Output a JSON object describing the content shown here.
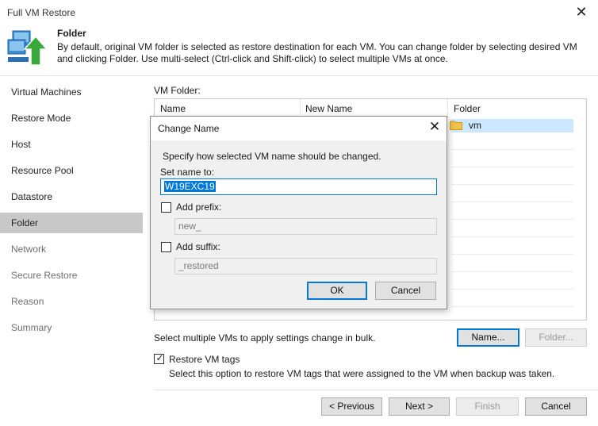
{
  "window": {
    "title": "Full VM Restore",
    "close_glyph": "✕"
  },
  "header": {
    "title": "Folder",
    "description": "By default, original VM folder is selected as restore destination for each VM. You can change folder by selecting desired VM and clicking Folder. Use multi-select (Ctrl-click and Shift-click) to select multiple VMs at once.",
    "icon": "vm-restore-icon"
  },
  "sidebar": {
    "items": [
      {
        "label": "Virtual Machines",
        "state": "normal"
      },
      {
        "label": "Restore Mode",
        "state": "normal"
      },
      {
        "label": "Host",
        "state": "normal"
      },
      {
        "label": "Resource Pool",
        "state": "normal"
      },
      {
        "label": "Datastore",
        "state": "normal"
      },
      {
        "label": "Folder",
        "state": "active"
      },
      {
        "label": "Network",
        "state": "disabled"
      },
      {
        "label": "Secure Restore",
        "state": "disabled"
      },
      {
        "label": "Reason",
        "state": "disabled"
      },
      {
        "label": "Summary",
        "state": "disabled"
      }
    ]
  },
  "main": {
    "vm_folder_label": "VM Folder:",
    "table": {
      "columns": [
        "Name",
        "New Name",
        "Folder"
      ],
      "rows": [
        {
          "folder": "vm",
          "selected": true
        }
      ]
    },
    "bulk_text": "Select multiple VMs to apply settings change in bulk.",
    "name_button": "Name...",
    "folder_button": "Folder...",
    "restore_tags": {
      "label": "Restore VM tags",
      "checked": true,
      "description": "Select this option to restore VM tags that were assigned to the VM when backup was taken."
    }
  },
  "footer": {
    "previous": "< Previous",
    "next": "Next >",
    "finish": "Finish",
    "cancel": "Cancel"
  },
  "dialog": {
    "title": "Change Name",
    "close_glyph": "✕",
    "description": "Specify how selected VM name should be changed.",
    "set_name_label": "Set name to:",
    "set_name_value": "W19EXC19",
    "prefix": {
      "label": "Add prefix:",
      "checked": false,
      "placeholder": "new_"
    },
    "suffix": {
      "label": "Add suffix:",
      "checked": false,
      "placeholder": "_restored"
    },
    "ok": "OK",
    "cancel": "Cancel"
  },
  "colors": {
    "accent": "#0078d7",
    "selection": "#cce8ff",
    "active_nav": "#c8c8c8",
    "folder_icon": "#f2c24a",
    "icon_green": "#3ca83c",
    "icon_blue": "#3a8fd4"
  }
}
